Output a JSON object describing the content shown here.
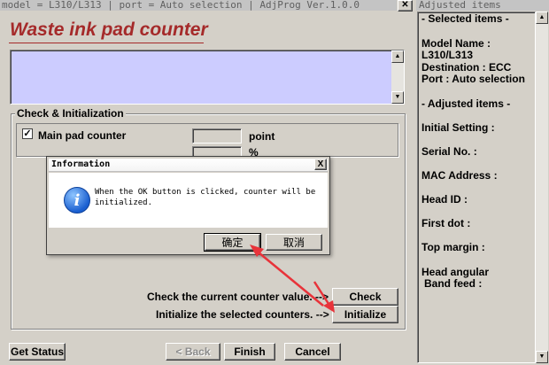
{
  "main": {
    "titlebar": "model = L310/L313 | port = Auto selection | AdjProg Ver.1.0.0",
    "heading": "Waste ink pad counter",
    "check_group_title": "Check & Initialization",
    "main_pad": {
      "label": "Main pad counter",
      "checked": true,
      "value": "",
      "unit": "point"
    },
    "second_unit": "%",
    "check_prompt": "Check the current counter value. -->",
    "check_button": "Check",
    "init_prompt": "Initialize the selected counters. -->",
    "init_button": "Initialize",
    "get_status_button": "Get Status",
    "back_button": "< Back",
    "finish_button": "Finish",
    "cancel_button": "Cancel"
  },
  "dialog": {
    "title": "Information",
    "close_glyph": "X",
    "message_line1": "When the OK button is clicked, counter will be",
    "message_line2": "initialized.",
    "ok_button": "确定",
    "cancel_button": "取消"
  },
  "side": {
    "titlebar": "Adjusted items",
    "selected_header": "- Selected items -",
    "model_name_label": "Model Name :",
    "model_name_value": "L310/L313",
    "destination": "Destination : ECC",
    "port": "Port : Auto selection",
    "adjusted_header": "- Adjusted items -",
    "items": [
      "Initial Setting :",
      "Serial No. :",
      "MAC Address :",
      "Head ID :",
      "First dot :",
      "Top margin :"
    ],
    "head_angular_line1": "Head angular",
    "head_angular_line2": "Band feed :"
  },
  "colors": {
    "heading": "#a52a2a",
    "textarea": "#ccccff",
    "info_icon": "#1a5fd0",
    "arrow": "#e8333a"
  }
}
